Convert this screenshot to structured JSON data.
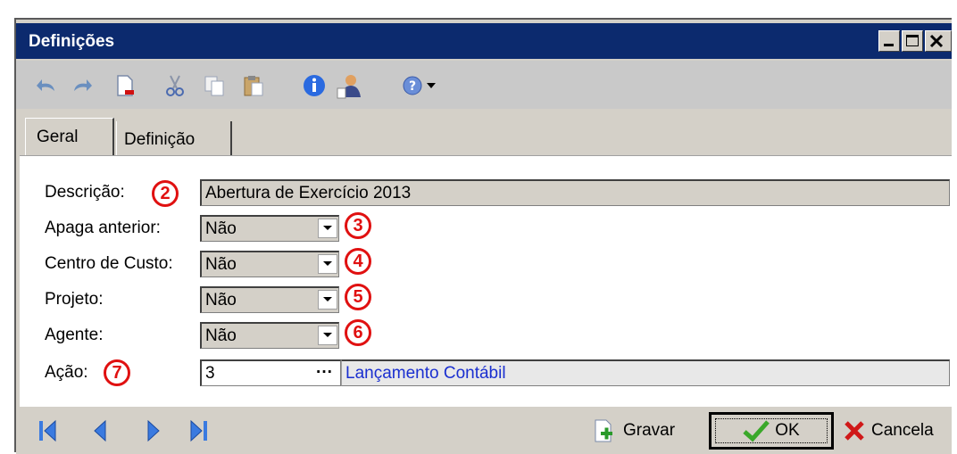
{
  "window": {
    "title": "Definições"
  },
  "tabs": [
    {
      "label": "Geral"
    },
    {
      "label": "Definição"
    }
  ],
  "form": {
    "descricao": {
      "label": "Descrição:",
      "value": "Abertura de Exercício 2013",
      "badge": "2"
    },
    "apaga_anterior": {
      "label": "Apaga anterior:",
      "value": "Não",
      "badge": "3"
    },
    "centro_custo": {
      "label": "Centro de Custo:",
      "value": "Não",
      "badge": "4"
    },
    "projeto": {
      "label": "Projeto:",
      "value": "Não",
      "badge": "5"
    },
    "agente": {
      "label": "Agente:",
      "value": "Não",
      "badge": "6"
    },
    "acao": {
      "label": "Ação:",
      "value": "3",
      "badge": "7",
      "lookup_text": "Lançamento Contábil",
      "dots": "···"
    }
  },
  "buttons": {
    "gravar": "Gravar",
    "ok": "OK",
    "cancela": "Cancela"
  },
  "colors": {
    "titlebar": "#0c2a6e",
    "badge": "#e01010",
    "link": "#1a2fd0"
  }
}
